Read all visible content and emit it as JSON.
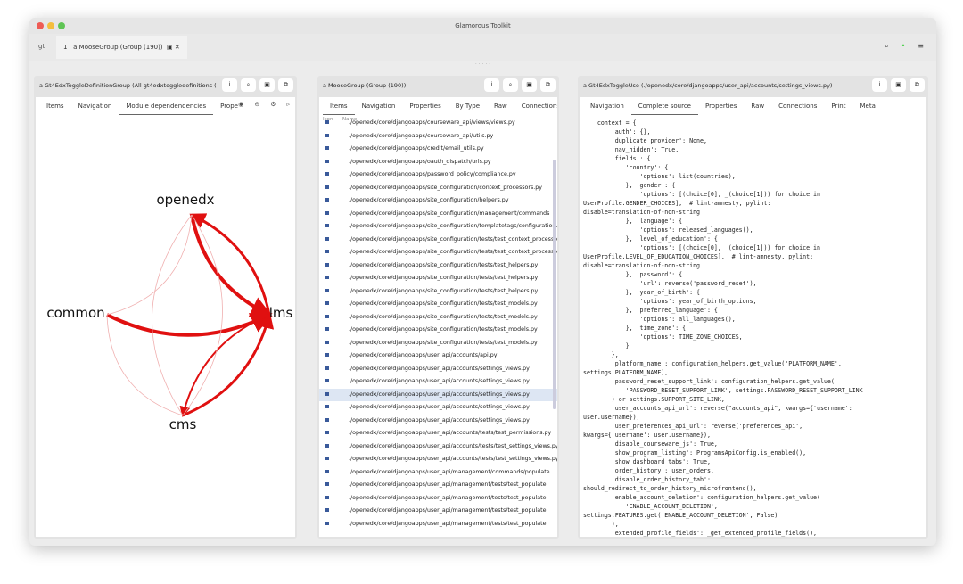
{
  "window": {
    "title": "Glamorous Toolkit"
  },
  "tabbar": {
    "gt": "gt",
    "tab_label": "a MooseGroup (Group (190))",
    "tab_index": "1",
    "icons": [
      "search-icon",
      "status-dot-icon",
      "menu-icon"
    ]
  },
  "strip": "· · · · ·",
  "pane1": {
    "title": "a Gt4EdxToggleDefinitionGroup (All gt4edxtoggledefinitions (",
    "tabs": [
      "Items",
      "Navigation",
      "Module dependendencies",
      "Prope"
    ],
    "active_tab": 2,
    "graph": {
      "nodes": [
        "openedx",
        "common",
        "lms",
        "cms"
      ],
      "edges": [
        {
          "from": "openedx",
          "to": "lms",
          "strength": 3
        },
        {
          "from": "lms",
          "to": "openedx",
          "strength": 2
        },
        {
          "from": "common",
          "to": "lms",
          "strength": 3
        },
        {
          "from": "cms",
          "to": "lms",
          "strength": 2
        },
        {
          "from": "lms",
          "to": "cms",
          "strength": 1
        },
        {
          "from": "common",
          "to": "openedx",
          "strength": 0
        },
        {
          "from": "openedx",
          "to": "cms",
          "strength": 0
        },
        {
          "from": "common",
          "to": "cms",
          "strength": 0
        },
        {
          "from": "cms",
          "to": "openedx",
          "strength": 0
        }
      ]
    }
  },
  "pane2": {
    "title": "a MooseGroup (Group (190))",
    "tabs": [
      "Items",
      "Navigation",
      "Properties",
      "By Type",
      "Raw",
      "Connections"
    ],
    "active_tab": 0,
    "col_icon": "Icon",
    "col_name": "Name",
    "rows": [
      "./openedx/core/djangoapps/courseware_api/views/views.py",
      "./openedx/core/djangoapps/courseware_api/utils.py",
      "./openedx/core/djangoapps/credit/email_utils.py",
      "./openedx/core/djangoapps/oauth_dispatch/urls.py",
      "./openedx/core/djangoapps/password_policy/compliance.py",
      "./openedx/core/djangoapps/site_configuration/context_processors.py",
      "./openedx/core/djangoapps/site_configuration/helpers.py",
      "./openedx/core/djangoapps/site_configuration/management/commands",
      "./openedx/core/djangoapps/site_configuration/templatetags/configuration.py",
      "./openedx/core/djangoapps/site_configuration/tests/test_context_processors.py",
      "./openedx/core/djangoapps/site_configuration/tests/test_context_processors.py",
      "./openedx/core/djangoapps/site_configuration/tests/test_helpers.py",
      "./openedx/core/djangoapps/site_configuration/tests/test_helpers.py",
      "./openedx/core/djangoapps/site_configuration/tests/test_helpers.py",
      "./openedx/core/djangoapps/site_configuration/tests/test_models.py",
      "./openedx/core/djangoapps/site_configuration/tests/test_models.py",
      "./openedx/core/djangoapps/site_configuration/tests/test_models.py",
      "./openedx/core/djangoapps/site_configuration/tests/test_models.py",
      "./openedx/core/djangoapps/user_api/accounts/api.py",
      "./openedx/core/djangoapps/user_api/accounts/settings_views.py",
      "./openedx/core/djangoapps/user_api/accounts/settings_views.py",
      "./openedx/core/djangoapps/user_api/accounts/settings_views.py",
      "./openedx/core/djangoapps/user_api/accounts/settings_views.py",
      "./openedx/core/djangoapps/user_api/accounts/settings_views.py",
      "./openedx/core/djangoapps/user_api/accounts/tests/test_permissions.py",
      "./openedx/core/djangoapps/user_api/accounts/tests/test_settings_views.py",
      "./openedx/core/djangoapps/user_api/accounts/tests/test_settings_views.py",
      "./openedx/core/djangoapps/user_api/management/commands/populate",
      "./openedx/core/djangoapps/user_api/management/tests/test_populate",
      "./openedx/core/djangoapps/user_api/management/tests/test_populate",
      "./openedx/core/djangoapps/user_api/management/tests/test_populate",
      "./openedx/core/djangoapps/user_api/management/tests/test_populate"
    ],
    "selected_row": 21
  },
  "pane3": {
    "title": "a Gt4EdxToggleUse (./openedx/core/djangoapps/user_api/accounts/settings_views.py)",
    "tabs": [
      "Navigation",
      "Complete source",
      "Properties",
      "Raw",
      "Connections",
      "Print",
      "Meta"
    ],
    "active_tab": 1,
    "code": [
      "    context = {",
      "        'auth': {},",
      "        'duplicate_provider': None,",
      "        'nav_hidden': True,",
      "        'fields': {",
      "            'country': {",
      "                'options': list(countries),",
      "            }, 'gender': {",
      "                'options': [(choice[0], _(choice[1])) for choice in",
      "UserProfile.GENDER_CHOICES],  # lint-amnesty, pylint:",
      "disable=translation-of-non-string",
      "            }, 'language': {",
      "                'options': released_languages(),",
      "            }, 'level_of_education': {",
      "                'options': [(choice[0], _(choice[1])) for choice in",
      "UserProfile.LEVEL_OF_EDUCATION_CHOICES],  # lint-amnesty, pylint:",
      "disable=translation-of-non-string",
      "            }, 'password': {",
      "                'url': reverse('password_reset'),",
      "            }, 'year_of_birth': {",
      "                'options': year_of_birth_options,",
      "            }, 'preferred_language': {",
      "                'options': all_languages(),",
      "            }, 'time_zone': {",
      "                'options': TIME_ZONE_CHOICES,",
      "            }",
      "        },",
      "        'platform_name': configuration_helpers.get_value('PLATFORM_NAME',",
      "settings.PLATFORM_NAME),",
      "        'password_reset_support_link': configuration_helpers.get_value(",
      "            'PASSWORD_RESET_SUPPORT_LINK', settings.PASSWORD_RESET_SUPPORT_LINK",
      "        ) or settings.SUPPORT_SITE_LINK,",
      "        'user_accounts_api_url': reverse(\"accounts_api\", kwargs={'username':",
      "user.username}),",
      "        'user_preferences_api_url': reverse('preferences_api',",
      "kwargs={'username': user.username}),",
      "        'disable_courseware_js': True,",
      "        'show_program_listing': ProgramsApiConfig.is_enabled(),",
      "        'show_dashboard_tabs': True,",
      "        'order_history': user_orders,",
      "        'disable_order_history_tab':",
      "should_redirect_to_order_history_microfrontend(),",
      "        'enable_account_deletion': configuration_helpers.get_value(",
      "            'ENABLE_ACCOUNT_DELETION',",
      "settings.FEATURES.get('ENABLE_ACCOUNT_DELETION', False)",
      "        ),",
      "        'extended_profile_fields': _get_extended_profile_fields(),"
    ]
  },
  "colors": {
    "edge": "#e01010",
    "edge_faint": "#f0b0b0",
    "selection": "#dde6f3"
  }
}
